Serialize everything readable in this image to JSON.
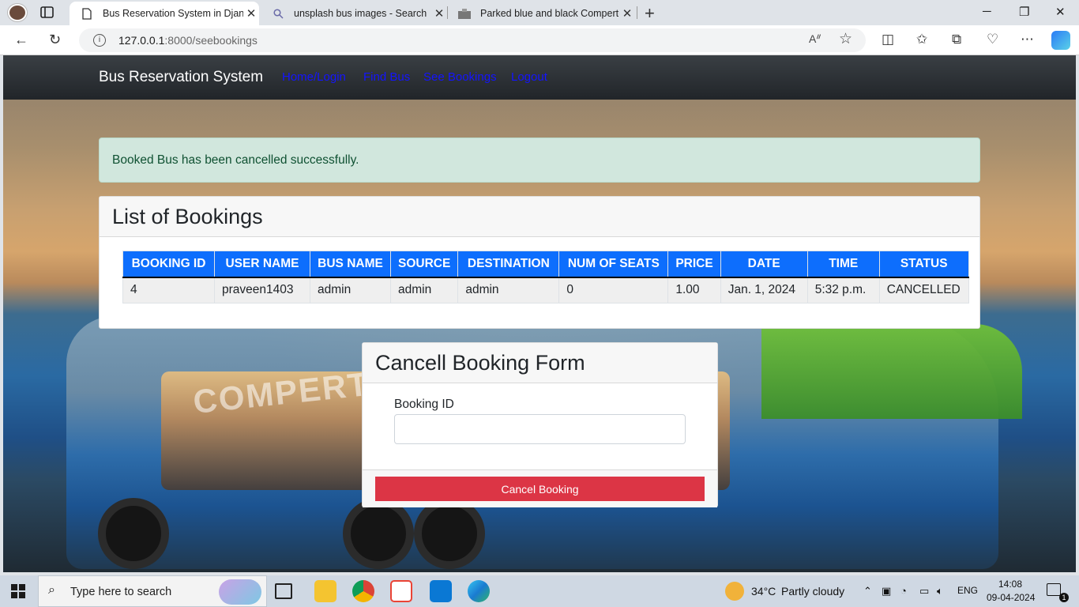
{
  "browser": {
    "tabs": [
      {
        "title": "Bus Reservation System in Django",
        "active": true
      },
      {
        "title": "unsplash bus images - Search",
        "active": false
      },
      {
        "title": "Parked blue and black Compertur",
        "active": false
      }
    ],
    "url_host": "127.0.0.1",
    "url_rest": ":8000/seebookings"
  },
  "navbar": {
    "brand": "Bus Reservation System",
    "links": [
      "Home/Login",
      "Find Bus",
      "See Bookings",
      "Logout"
    ]
  },
  "alert": {
    "message": "Booked Bus has been cancelled successfully."
  },
  "bookings": {
    "title": "List of Bookings",
    "columns": [
      "BOOKING ID",
      "USER NAME",
      "BUS NAME",
      "SOURCE",
      "DESTINATION",
      "NUM OF SEATS",
      "PRICE",
      "DATE",
      "TIME",
      "STATUS"
    ],
    "rows": [
      [
        "4",
        "praveen1403",
        "admin",
        "admin",
        "admin",
        "0",
        "1.00",
        "Jan. 1, 2024",
        "5:32 p.m.",
        "CANCELLED"
      ]
    ]
  },
  "cancel_form": {
    "title": "Cancell Booking Form",
    "field_label": "Booking ID",
    "field_value": "",
    "submit_label": "Cancel Booking"
  },
  "background": {
    "bus_brand": "COMPERTUR"
  },
  "taskbar": {
    "search_placeholder": "Type here to search",
    "weather_temp": "34°C",
    "weather_text": "Partly cloudy",
    "language": "ENG",
    "time": "14:08",
    "date": "09-04-2024",
    "notification_count": "1"
  },
  "colors": {
    "navbar": "#212529",
    "primary": "#0d6efd",
    "danger": "#dc3545",
    "alert_bg": "#d1e7dd",
    "nav_link": "#1414ff"
  }
}
